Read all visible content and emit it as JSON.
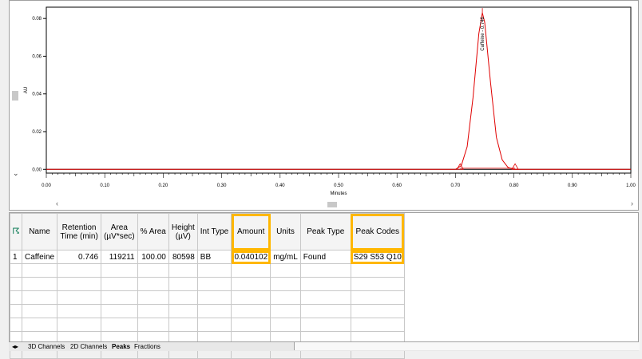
{
  "chart": {
    "y_axis_label": "AU",
    "x_axis_label": "Minutes",
    "y_ticks": [
      "0.08",
      "0.06",
      "0.04",
      "0.02",
      "0.00"
    ],
    "x_ticks": [
      "0.00",
      "0.10",
      "0.20",
      "0.30",
      "0.40",
      "0.50",
      "0.60",
      "0.70",
      "0.80",
      "0.90",
      "1.00"
    ],
    "peak_label": "Caffeine - 0.746",
    "peak_rt": 0.746,
    "peak_height": 0.083,
    "peak_start": 0.708,
    "peak_end": 0.802,
    "x_range": [
      0.0,
      1.0
    ],
    "y_range": [
      -0.002,
      0.086
    ],
    "trace_color": "#e00000"
  },
  "chart_data": {
    "type": "line",
    "xlabel": "Minutes",
    "ylabel": "AU",
    "xlim": [
      0.0,
      1.0
    ],
    "ylim": [
      0.0,
      0.08
    ],
    "series": [
      {
        "x": [
          0.0,
          0.7,
          0.71,
          0.72,
          0.73,
          0.74,
          0.746,
          0.75,
          0.76,
          0.77,
          0.78,
          0.79,
          0.8,
          1.0
        ],
        "values": [
          0.0,
          0.0,
          0.002,
          0.012,
          0.038,
          0.072,
          0.083,
          0.078,
          0.046,
          0.017,
          0.005,
          0.001,
          0.0,
          0.0
        ]
      }
    ],
    "annotations": [
      "Caffeine - 0.746"
    ]
  },
  "table": {
    "headers": [
      "Name",
      "Retention Time (min)",
      "Area (µV*sec)",
      "% Area",
      "Height (µV)",
      "Int Type",
      "Amount",
      "Units",
      "Peak Type",
      "Peak Codes"
    ],
    "rows": [
      [
        "1",
        "Caffeine",
        "0.746",
        "119211",
        "100.00",
        "80598",
        "BB",
        "0.040102",
        "mg/mL",
        "Found",
        "S29 S53 Q10"
      ]
    ]
  },
  "tabs": [
    "3D Channels",
    "2D Channels",
    "Peaks",
    "Fractions"
  ],
  "highlight_color": "#ffb700"
}
